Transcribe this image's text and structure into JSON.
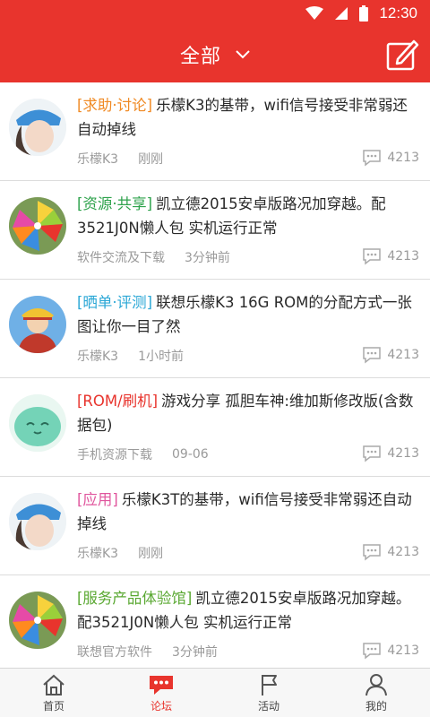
{
  "status_bar": {
    "time": "12:30"
  },
  "header": {
    "title": "全部"
  },
  "posts": [
    {
      "tag": "[求助·讨论]",
      "tag_color": "#f08a24",
      "title": "乐檬K3的基带，wifi信号接受非常弱还自动掉线",
      "board": "乐檬K3",
      "time": "刚刚",
      "replies": "4213",
      "avatar": "girl-cap"
    },
    {
      "tag": "[资源·共享]",
      "tag_color": "#2da24b",
      "title": "凯立德2015安卓版路况加穿越。配3521J0N懒人包 实机运行正常",
      "board": "软件交流及下载",
      "time": "3分钟前",
      "replies": "4213",
      "avatar": "pinwheel"
    },
    {
      "tag": "[晒单·评测]",
      "tag_color": "#2aa7d6",
      "title": "联想乐檬K3 16G ROM的分配方式一张图让你一目了然",
      "board": "乐檬K3",
      "time": "1小时前",
      "replies": "4213",
      "avatar": "pirate"
    },
    {
      "tag": "[ROM/刷机]",
      "tag_color": "#e8342d",
      "title": "游戏分享 孤胆车神:维加斯修改版(含数据包)",
      "board": "手机资源下载",
      "time": "09-06",
      "replies": "4213",
      "avatar": "mint-face"
    },
    {
      "tag": "[应用]",
      "tag_color": "#e0559d",
      "title": "乐檬K3T的基带，wifi信号接受非常弱还自动掉线",
      "board": "乐檬K3",
      "time": "刚刚",
      "replies": "4213",
      "avatar": "girl-cap"
    },
    {
      "tag": "[服务产品体验馆]",
      "tag_color": "#5aa832",
      "title": "凯立德2015安卓版路况加穿越。配3521J0N懒人包 实机运行正常",
      "board": "联想官方软件",
      "time": "3分钟前",
      "replies": "4213",
      "avatar": "pinwheel"
    }
  ],
  "tabs": [
    {
      "label": "首页",
      "icon": "home-icon",
      "active": false
    },
    {
      "label": "论坛",
      "icon": "forum-icon",
      "active": true
    },
    {
      "label": "活动",
      "icon": "flag-icon",
      "active": false
    },
    {
      "label": "我的",
      "icon": "user-icon",
      "active": false
    }
  ],
  "colors": {
    "accent": "#e8342d",
    "meta": "#9a9a9a"
  }
}
